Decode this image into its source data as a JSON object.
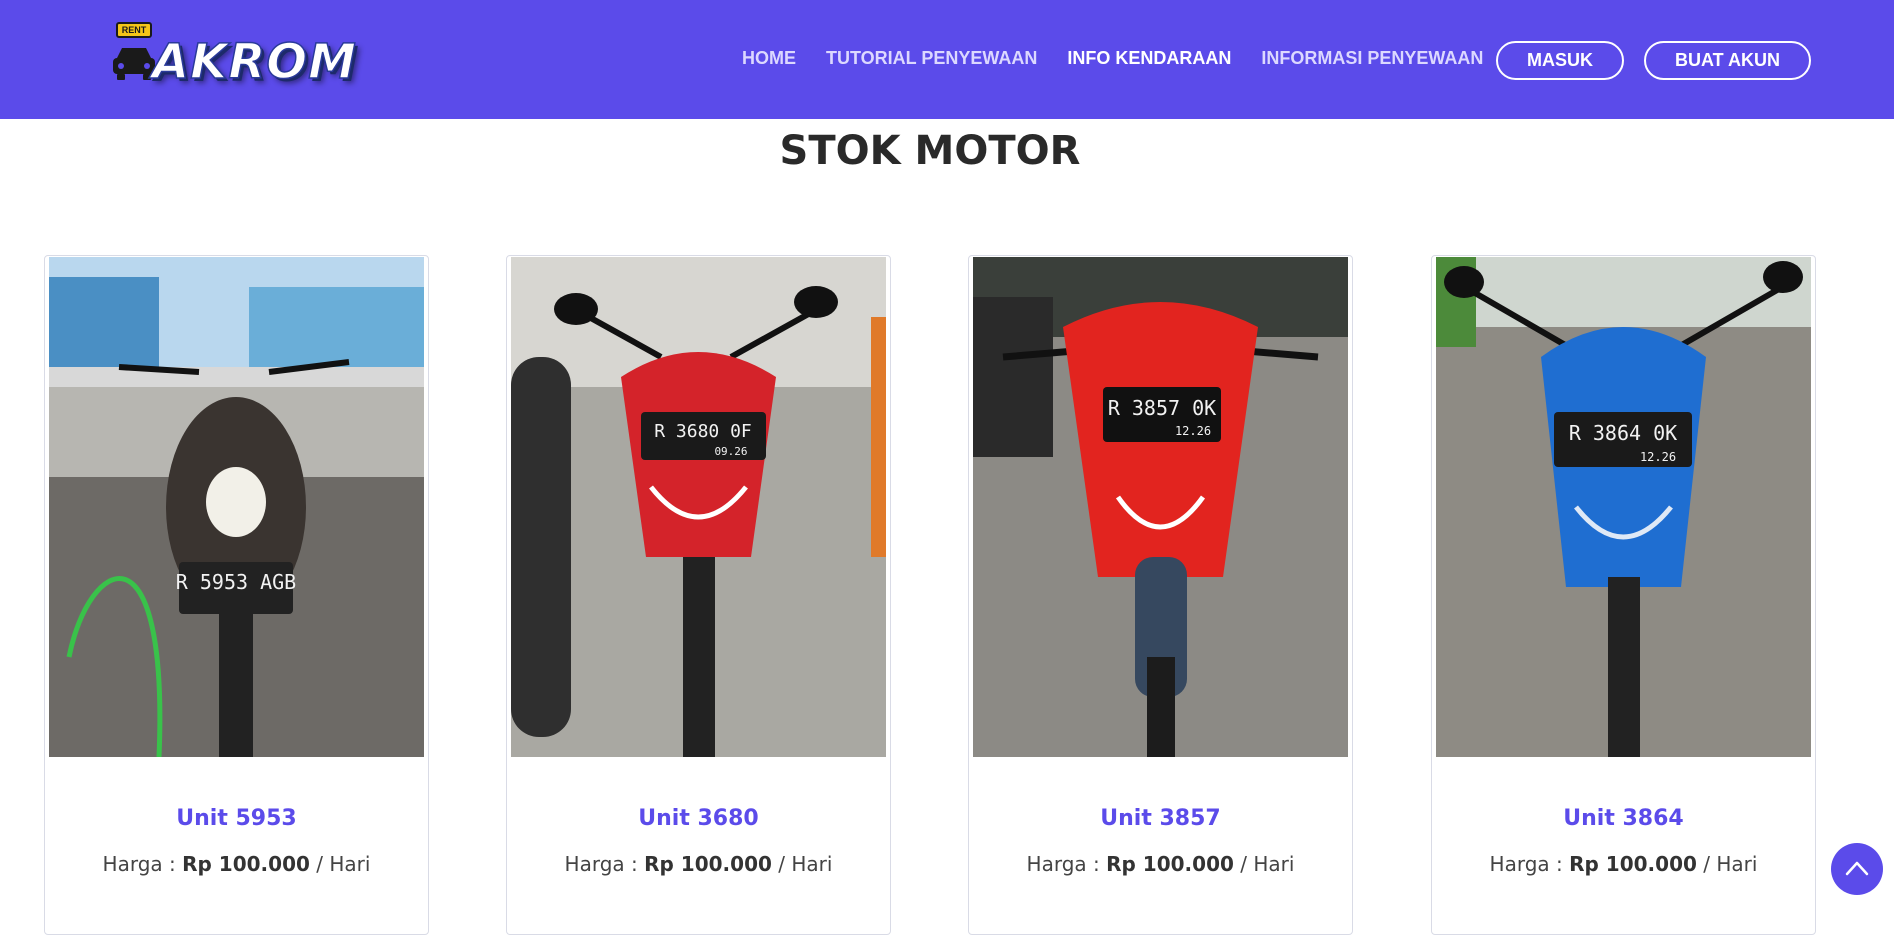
{
  "brand": {
    "badge": "RENT",
    "name": "AKROM"
  },
  "nav": {
    "items": [
      {
        "label": "HOME",
        "active": false
      },
      {
        "label": "TUTORIAL PENYEWAAN",
        "active": false
      },
      {
        "label": "INFO KENDARAAN",
        "active": true
      },
      {
        "label": "INFORMASI PENYEWAAN",
        "active": false
      }
    ],
    "login_label": "MASUK",
    "register_label": "BUAT AKUN"
  },
  "section": {
    "title": "STOK MOTOR"
  },
  "cards": [
    {
      "unit": "Unit 5953",
      "price_prefix": "Harga : ",
      "price": "Rp 100.000",
      "price_suffix": " / Hari",
      "plate_top": "R 5953 AGB",
      "plate_bottom": "",
      "body_color": "#3a3430"
    },
    {
      "unit": "Unit 3680",
      "price_prefix": "Harga : ",
      "price": "Rp 100.000",
      "price_suffix": " / Hari",
      "plate_top": "R 3680 0F",
      "plate_bottom": "09.26",
      "body_color": "#d4232a"
    },
    {
      "unit": "Unit 3857",
      "price_prefix": "Harga : ",
      "price": "Rp 100.000",
      "price_suffix": " / Hari",
      "plate_top": "R 3857 0K",
      "plate_bottom": "12.26",
      "body_color": "#e2241f"
    },
    {
      "unit": "Unit 3864",
      "price_prefix": "Harga : ",
      "price": "Rp 100.000",
      "price_suffix": " / Hari",
      "plate_top": "R 3864 0K",
      "plate_bottom": "12.26",
      "body_color": "#1f6ed1"
    }
  ],
  "colors": {
    "primary": "#5b4bea",
    "title": "#2a2a2a"
  },
  "icons": {
    "scroll_top": "chevron-up-icon",
    "logo": "car-icon"
  }
}
